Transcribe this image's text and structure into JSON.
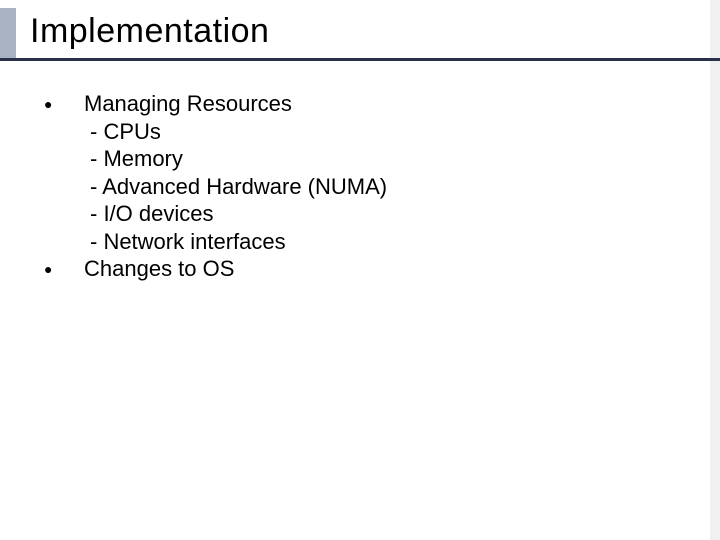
{
  "title": "Implementation",
  "bullets": [
    {
      "text": "Managing Resources",
      "subitems": [
        "- CPUs",
        "- Memory",
        "- Advanced Hardware (NUMA)",
        "- I/O devices",
        "- Network interfaces"
      ]
    },
    {
      "text": "Changes to OS",
      "subitems": []
    }
  ]
}
